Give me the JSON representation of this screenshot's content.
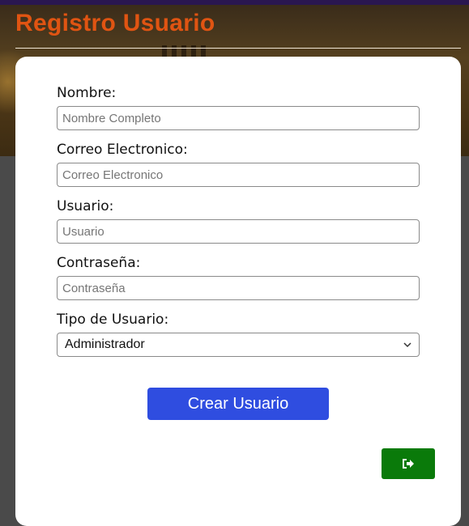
{
  "header": {
    "title": "Registro Usuario"
  },
  "form": {
    "fields": [
      {
        "label": "Nombre:",
        "placeholder": "Nombre Completo",
        "value": ""
      },
      {
        "label": "Correo Electronico:",
        "placeholder": "Correo Electronico",
        "value": ""
      },
      {
        "label": "Usuario:",
        "placeholder": "Usuario",
        "value": ""
      },
      {
        "label": "Contraseña:",
        "placeholder": "Contraseña",
        "value": ""
      }
    ],
    "user_type": {
      "label": "Tipo de Usuario:",
      "selected": "Administrador"
    },
    "submit_label": "Crear Usuario"
  },
  "logout": {
    "icon": "sign-out-icon",
    "color": "#0a7a0a"
  },
  "colors": {
    "title": "#e05412",
    "primary_button": "#2f4de0",
    "logout_button": "#0a7a0a"
  }
}
